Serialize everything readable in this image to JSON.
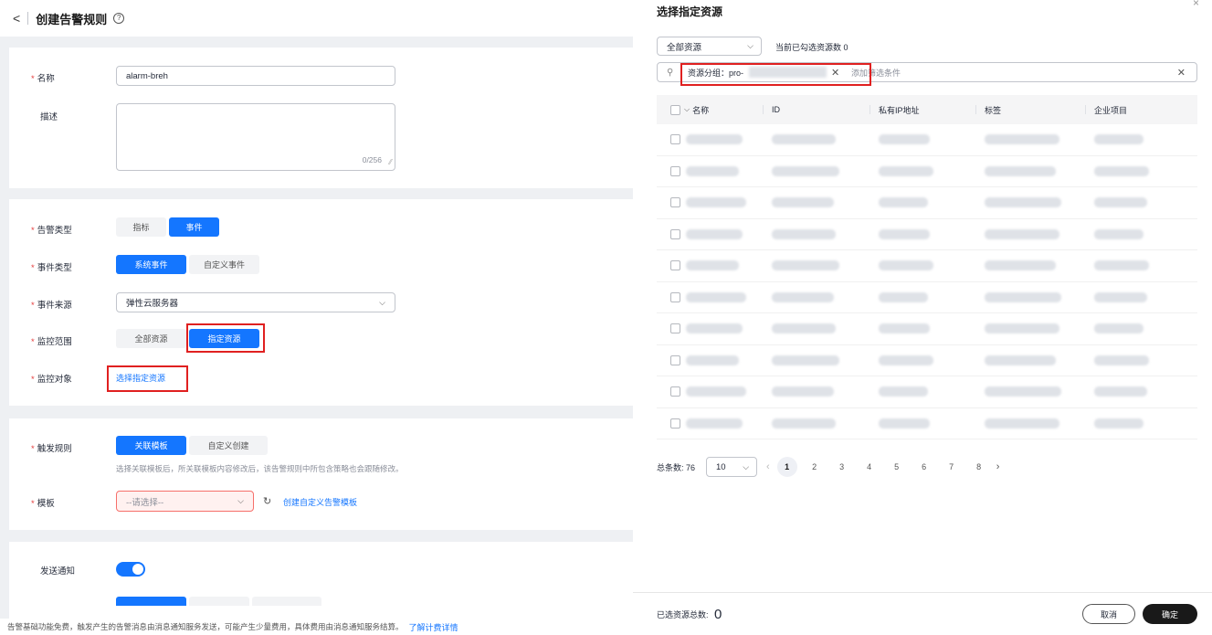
{
  "header": {
    "back": "<",
    "title": "创建告警规则",
    "help": "?"
  },
  "basic": {
    "name_label": "名称",
    "name_value": "alarm-breh",
    "desc_label": "描述",
    "desc_counter": "0/256"
  },
  "config": {
    "alarm_type_label": "告警类型",
    "alarm_type_options": [
      "指标",
      "事件"
    ],
    "event_type_label": "事件类型",
    "event_type_options": [
      "系统事件",
      "自定义事件"
    ],
    "event_source_label": "事件来源",
    "event_source_value": "弹性云服务器",
    "scope_label": "监控范围",
    "scope_options": [
      "全部资源",
      "指定资源"
    ],
    "target_label": "监控对象",
    "target_link": "选择指定资源"
  },
  "trigger": {
    "rule_label": "触发规则",
    "rule_options": [
      "关联模板",
      "自定义创建"
    ],
    "hint": "选择关联模板后，所关联模板内容修改后，该告警规则中所包含策略也会跟随修改。",
    "template_label": "模板",
    "template_placeholder": "--请选择--",
    "create_template_link": "创建自定义告警模板"
  },
  "notify": {
    "send_label": "发送通知"
  },
  "footer": {
    "text": "告警基础功能免费，触发产生的告警消息由消息通知服务发送，可能产生少量费用，具体费用由消息通知服务结算。",
    "link": "了解计费详情"
  },
  "panel": {
    "title": "选择指定资源",
    "scope_select": "全部资源",
    "selected_count_text": "当前已勾选资源数 0",
    "filter_tag": "资源分组：pro-",
    "filter_placeholder": "添加筛选条件",
    "columns": [
      "名称",
      "ID",
      "私有IP地址",
      "标签",
      "企业项目"
    ],
    "total_label": "总条数: 76",
    "page_size": "10",
    "pages": [
      "1",
      "2",
      "3",
      "4",
      "5",
      "6",
      "7",
      "8"
    ],
    "selected_total_label": "已选资源总数:",
    "selected_total_value": "0",
    "cancel": "取消",
    "confirm": "确定"
  },
  "colors": {
    "primary": "#1476ff",
    "danger": "#e02020"
  }
}
